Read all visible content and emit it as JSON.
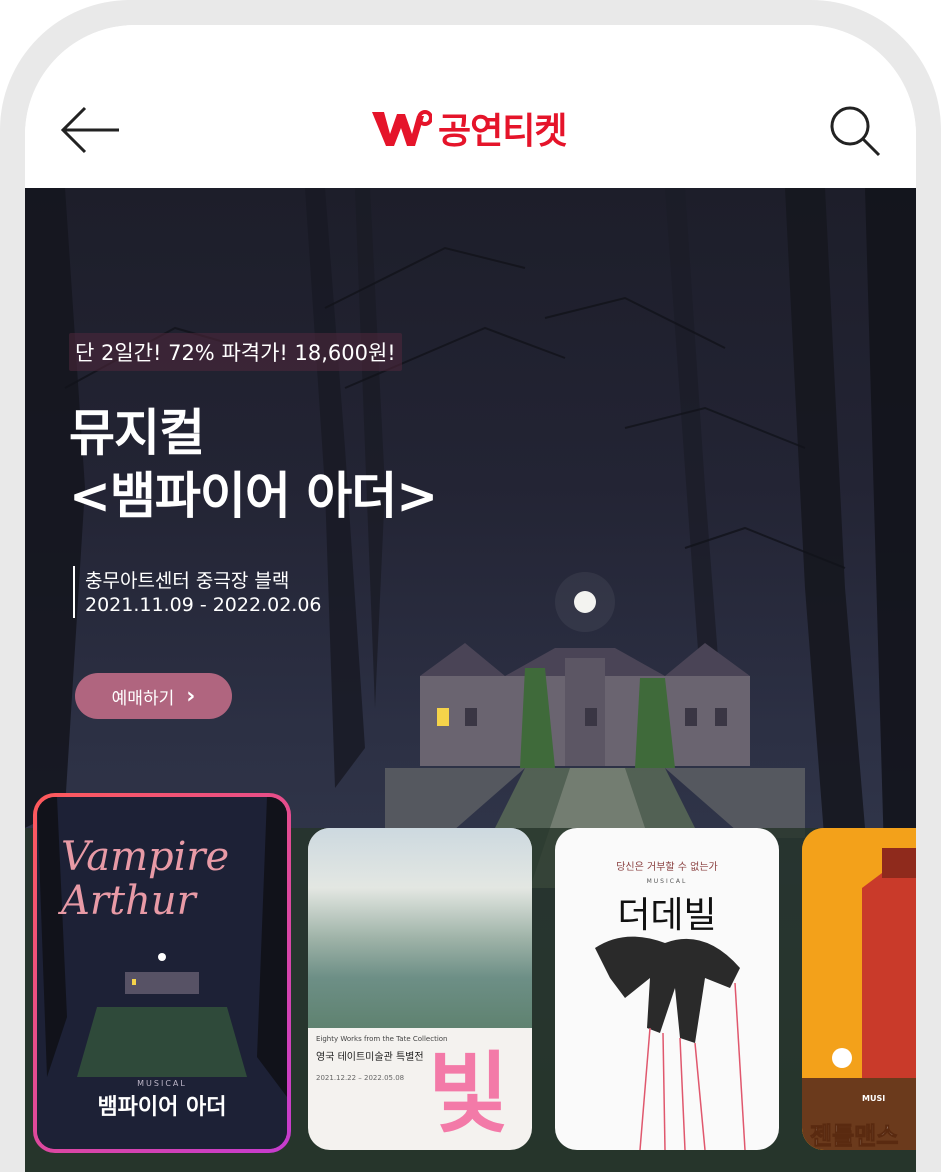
{
  "header": {
    "logo_text": "공연티켓",
    "back_label": "back",
    "search_label": "search"
  },
  "hero": {
    "promo": "단 2일간! 72% 파격가! 18,600원!",
    "title_line1": "뮤지컬",
    "title_line2": "<뱀파이어 아더>",
    "venue": "충무아트센터 중극장 블랙",
    "dates": "2021.11.09 - 2022.02.06",
    "book_button": "예매하기",
    "book_arrow": "›"
  },
  "cards": [
    {
      "script_title": "Vampire\nArthur",
      "sub": "MUSICAL",
      "title": "뱀파이어 아더"
    },
    {
      "caption1": "Eighty Works from the Tate Collection",
      "caption2": "영국 테이트미술관 특별전",
      "caption3": "2021.12.22 – 2022.05.08",
      "big_text": "빛"
    },
    {
      "tagline": "당신은 거부할 수 없는가",
      "small": "MUSICAL",
      "title": "더데빌"
    },
    {
      "small": "MUSI",
      "title": "젠틀맨스"
    }
  ],
  "colors": {
    "brand": "#e5142a",
    "book_button": "#b0657f",
    "card_border_start": "#ff5a5a",
    "card_border_end": "#c53bd0"
  },
  "icons": [
    "back-arrow-icon",
    "search-icon",
    "chevron-right-icon"
  ]
}
